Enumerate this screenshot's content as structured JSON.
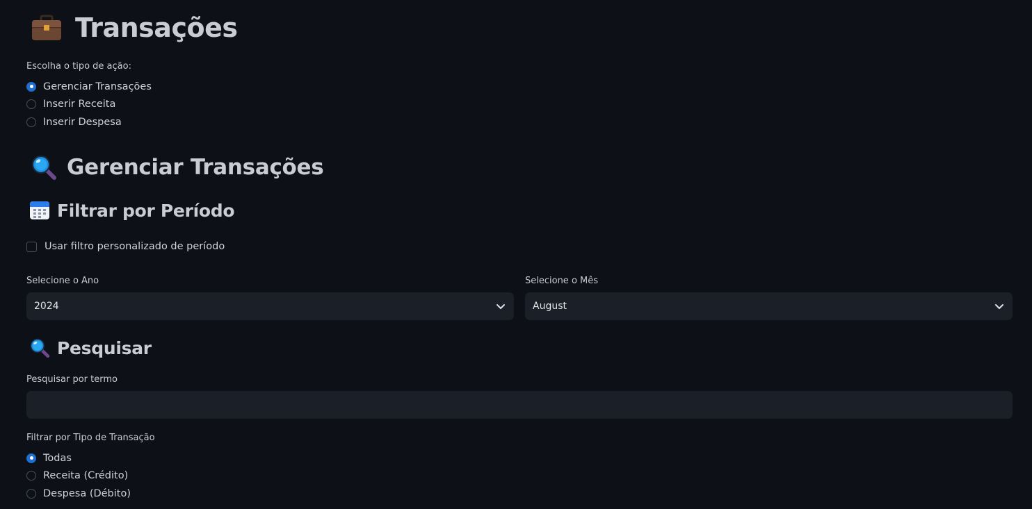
{
  "header": {
    "title": "Transações",
    "title_icon": "briefcase-icon"
  },
  "action_choice": {
    "label": "Escolha o tipo de ação:",
    "options": [
      "Gerenciar Transações",
      "Inserir Receita",
      "Inserir Despesa"
    ],
    "selected": "Gerenciar Transações"
  },
  "manage_section": {
    "title": "Gerenciar Transações",
    "icon": "magnifier-icon"
  },
  "period_filter": {
    "title": "Filtrar por Período",
    "icon": "calendar-icon",
    "custom_checkbox_label": "Usar filtro personalizado de período",
    "custom_checked": false,
    "year_label": "Selecione o Ano",
    "year_value": "2024",
    "month_label": "Selecione o Mês",
    "month_value": "August"
  },
  "search": {
    "title": "Pesquisar",
    "icon": "magnifier-icon",
    "term_label": "Pesquisar por termo",
    "term_value": ""
  },
  "transaction_type": {
    "label": "Filtrar por Tipo de Transação",
    "options": [
      "Todas",
      "Receita (Crédito)",
      "Despesa (Débito)"
    ],
    "selected": "Todas"
  },
  "colors": {
    "background": "#0d1117",
    "input_background": "#1b1f28",
    "accent": "#1f6fd1",
    "text": "#d0d3da"
  }
}
